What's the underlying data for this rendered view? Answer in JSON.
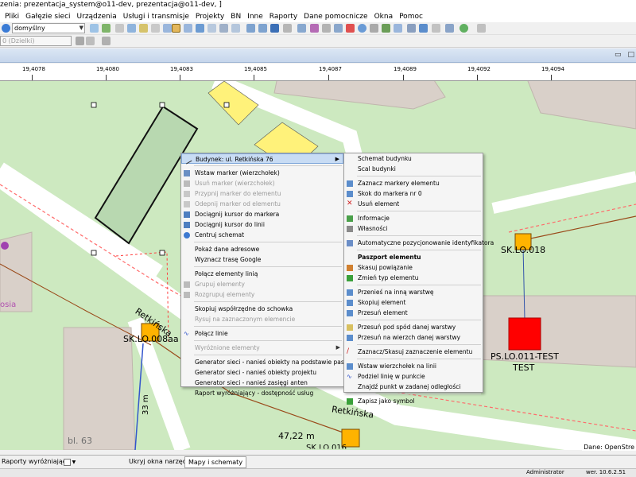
{
  "window": {
    "title": "zenia: prezentacja_system@o11-dev, prezentacja@o11-dev, ]"
  },
  "menu": [
    "Pliki",
    "Gałęzie sieci",
    "Urządzenia",
    "Usługi i transmisje",
    "Projekty",
    "BN",
    "Inne",
    "Raporty",
    "Dane pomocnicze",
    "Okna",
    "Pomoc"
  ],
  "toolbar": {
    "style_combo": "domyślny",
    "layer_combo": "0 (Dzielki)"
  },
  "ruler": {
    "labels": [
      "19,4078",
      "19,4080",
      "19,4083",
      "19,4085",
      "19,4087",
      "19,4089",
      "19,4092",
      "19,4094"
    ]
  },
  "map": {
    "labels": {
      "sk_lo_008aa": "SK.LO.008aa",
      "sk_lo_018": "SK.LO.018",
      "ps_lo_011": "PS.LO.011-TEST",
      "test": "TEST",
      "street_retkinska": "Retkińska",
      "street_retkinska2": "Retkińska",
      "len_33": "33 m",
      "len_4722": "47,22 m",
      "bl63": "bl. 63",
      "osia": "osia",
      "sk_bottom": "SK.LO.016"
    },
    "date_label": "Dane: OpenStre"
  },
  "context_menu": {
    "header": "Budynek: ul. Retkińska 76",
    "items": [
      {
        "label": "Wstaw marker (wierzchołek)",
        "disabled": false
      },
      {
        "label": "Usuń marker (wierzchołek)",
        "disabled": true
      },
      {
        "label": "Przypnij marker do elementu",
        "disabled": true
      },
      {
        "label": "Odepnij marker od elementu",
        "disabled": true
      },
      {
        "label": "Dociągnij kursor do markera",
        "disabled": false
      },
      {
        "label": "Dociągnij kursor do linii",
        "disabled": false
      },
      {
        "label": "Centruj schemat",
        "disabled": false
      },
      {
        "label": "Pokaż dane adresowe",
        "disabled": false
      },
      {
        "label": "Wyznacz trasę Google",
        "disabled": false
      },
      {
        "label": "Połącz elementy linią",
        "disabled": false
      },
      {
        "label": "Grupuj elementy",
        "disabled": true
      },
      {
        "label": "Rozgrupuj elementy",
        "disabled": true
      },
      {
        "label": "Skopiuj współrzędne do schowka",
        "disabled": false
      },
      {
        "label": "Rysuj na zaznaczonym elemencie",
        "disabled": true
      },
      {
        "label": "Połącz linie",
        "disabled": false
      },
      {
        "label": "Wyróżnione elementy",
        "disabled": true
      },
      {
        "label": "Generator sieci - nanieś obiekty na podstawie paszportów",
        "disabled": false
      },
      {
        "label": "Generator sieci - nanieś obiekty projektu",
        "disabled": false
      },
      {
        "label": "Generator sieci - nanieś zasięgi anten",
        "disabled": false
      },
      {
        "label": "Raport wyróżniający - dostępność usług",
        "disabled": false
      }
    ]
  },
  "submenu": {
    "items": [
      "Schemat budynku",
      "Scal budynki",
      "Zaznacz markery elementu",
      "Skok do markera nr 0",
      "Usuń element",
      "Informacje",
      "Własności",
      "Automatyczne pozycjonowanie identyfikatora",
      "Paszport elementu",
      "Skasuj powiązanie",
      "Zmień typ elementu",
      "Przenieś na inną warstwę",
      "Skopiuj element",
      "Przesuń element",
      "Przesuń pod spód danej warstwy",
      "Przesuń na wierzch danej warstwy",
      "Zaznacz/Skasuj zaznaczenie elementu",
      "Wstaw wierzchołek na linii",
      "Podziel linię w punkcie",
      "Znajdź punkt w zadanej odległości",
      "Zapisz jako symbol"
    ]
  },
  "bottom": {
    "reports_button": "Raporty wyróżniające",
    "hide_tools": "Ukryj okna narzędzi",
    "maps_tab": "Mapy i schematy"
  },
  "status": {
    "user": "Administrator",
    "version": "wer. 10.6.2.51"
  },
  "colors": {
    "map_bg": "#cde9c0",
    "road": "#ffffff",
    "building": "#d9d0c9",
    "yellow_building": "#fff27a",
    "node_orange": "#ffb300",
    "node_red": "#ff0000",
    "highlight": "#c8dcf4"
  }
}
